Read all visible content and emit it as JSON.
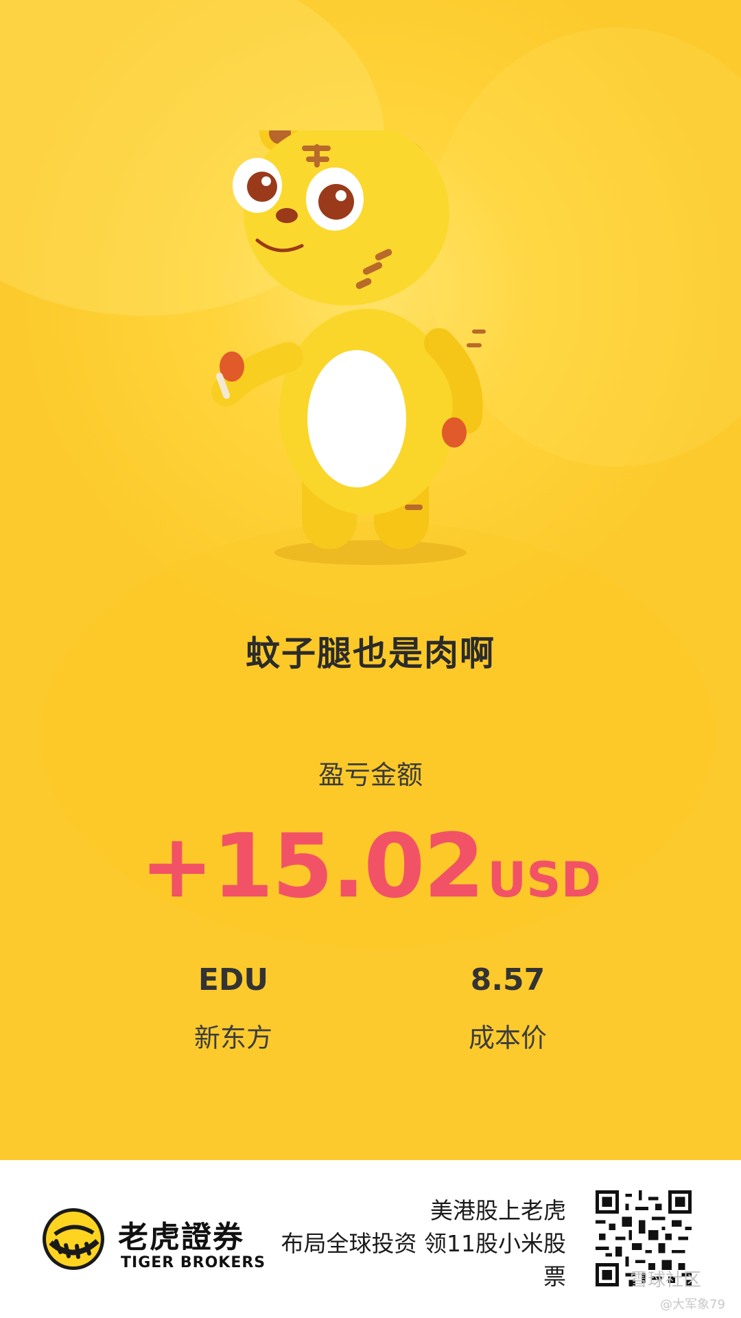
{
  "share_card": {
    "motto": "蚊子腿也是肉啊",
    "pl_label": "盈亏金额",
    "pl_amount": "+15.02",
    "pl_unit": "USD",
    "stock_symbol": "EDU",
    "stock_name": "新东方",
    "cost_price": "8.57",
    "cost_price_label": "成本价",
    "amount_color": "#f25266",
    "background_color": "#fcd33a"
  },
  "footer": {
    "brand_cn": "老虎證券",
    "brand_en": "TIGER BROKERS",
    "promo_lines": [
      "美港股上老虎",
      "布局全球投资 领11股小米股",
      "票"
    ],
    "watermark": "雪球社区",
    "watermark_user": "@大军象79"
  },
  "icons": {
    "mascot": "tiger-mascot-icon",
    "logo": "tiger-brokers-logo-icon",
    "qr": "qr-code-icon"
  }
}
